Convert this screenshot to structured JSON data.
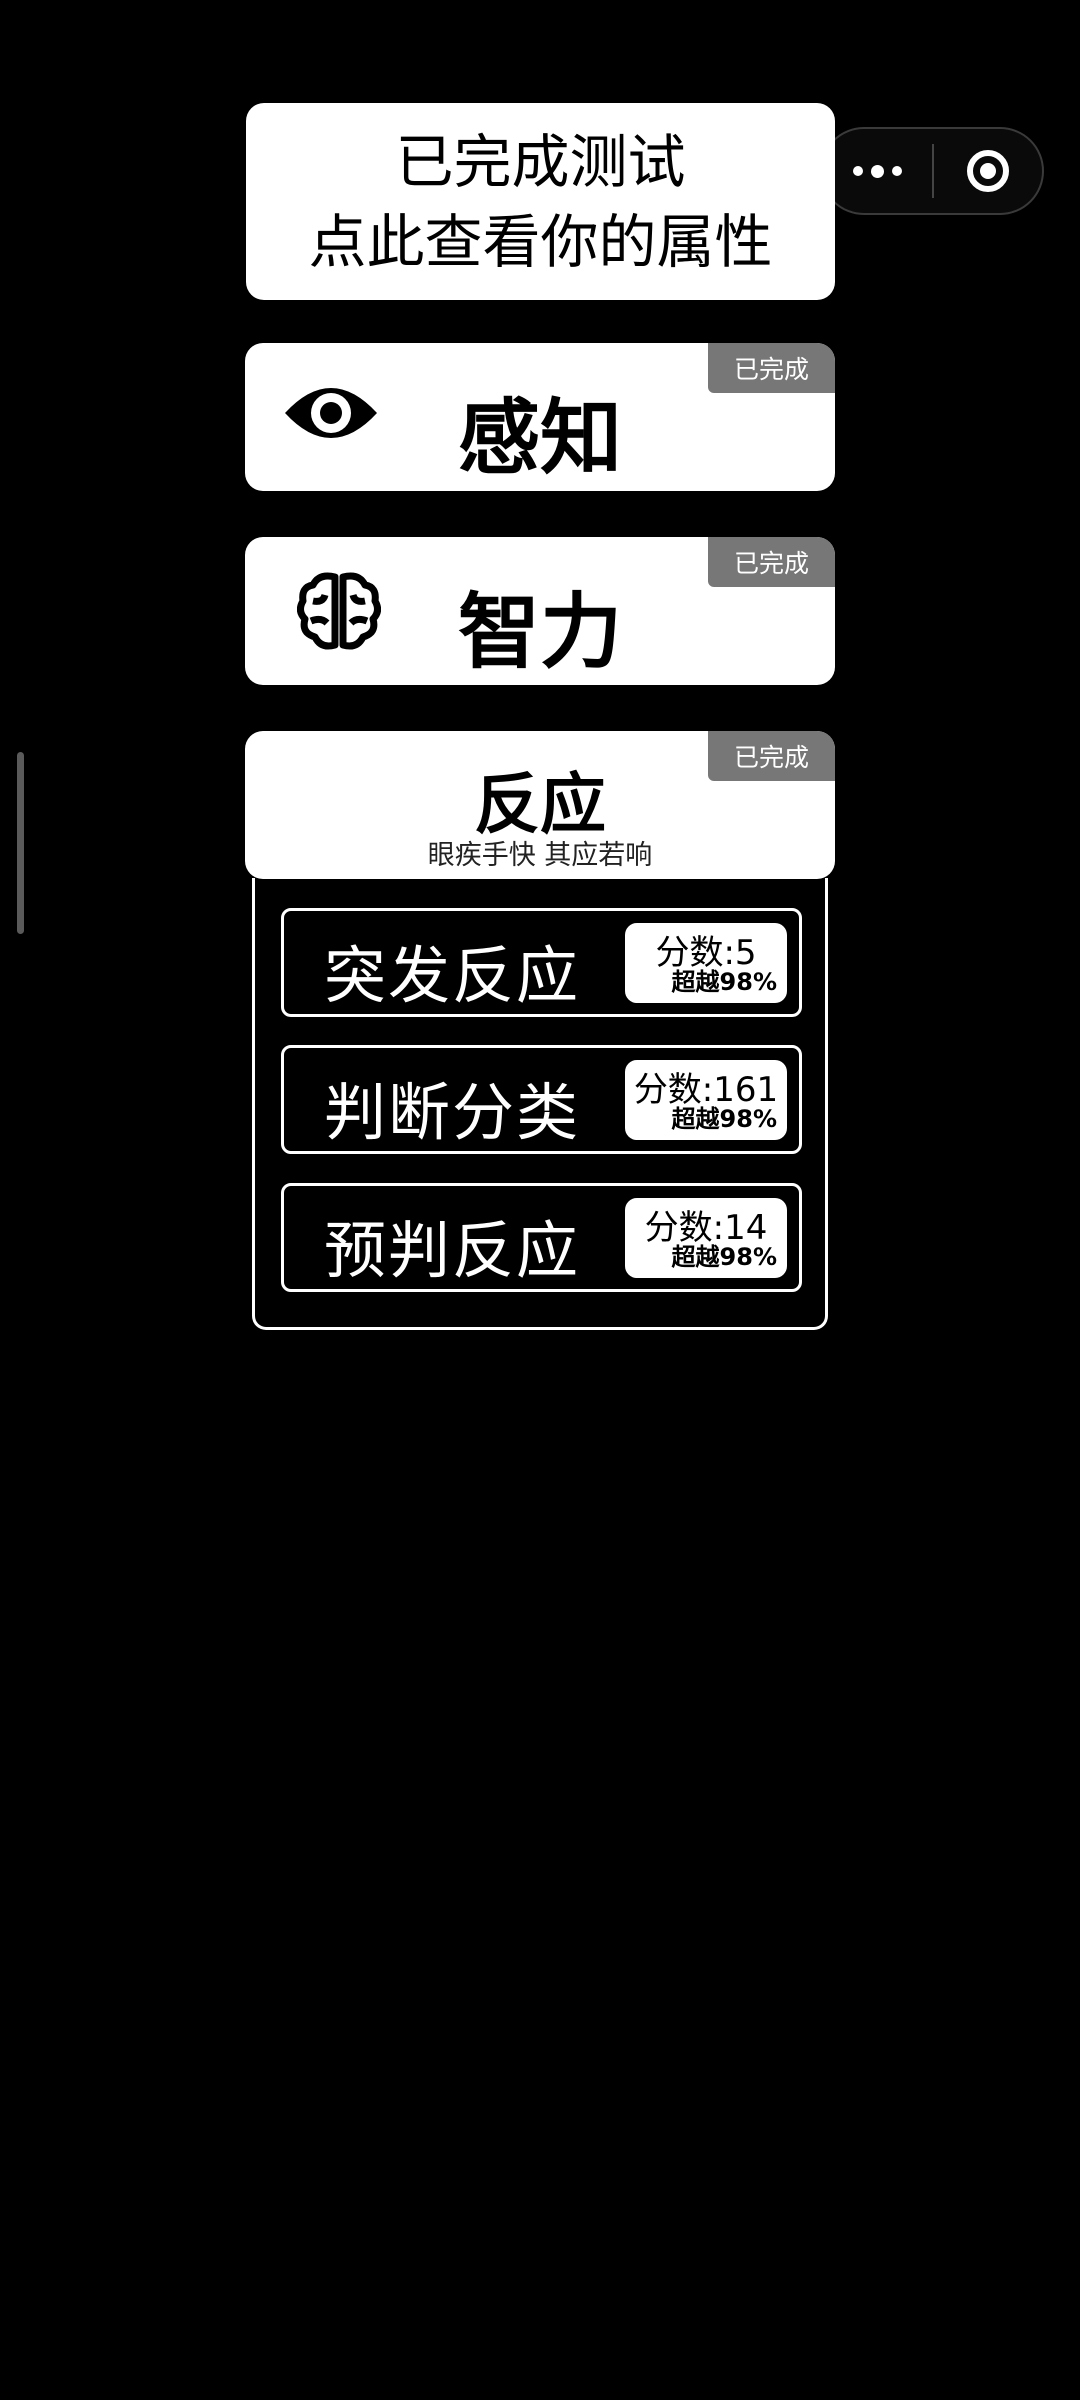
{
  "capsule": {
    "more_icon": "more-dots-icon",
    "close_icon": "target-circle-icon"
  },
  "result_card": {
    "line1": "已完成测试",
    "line2": "点此查看你的属性"
  },
  "categories": [
    {
      "title": "感知",
      "badge": "已完成",
      "icon": "eye-icon"
    },
    {
      "title": "智力",
      "badge": "已完成",
      "icon": "brain-icon"
    },
    {
      "title": "反应",
      "subtitle": "眼疾手快 其应若响",
      "badge": "已完成"
    }
  ],
  "reaction_tests": [
    {
      "label": "突发反应",
      "score": "分数:5",
      "rank": "超越98%"
    },
    {
      "label": "判断分类",
      "score": "分数:161",
      "rank": "超越98%"
    },
    {
      "label": "预判反应",
      "score": "分数:14",
      "rank": "超越98%"
    }
  ],
  "colors": {
    "background": "#000000",
    "card": "#ffffff",
    "badge": "#777777"
  }
}
